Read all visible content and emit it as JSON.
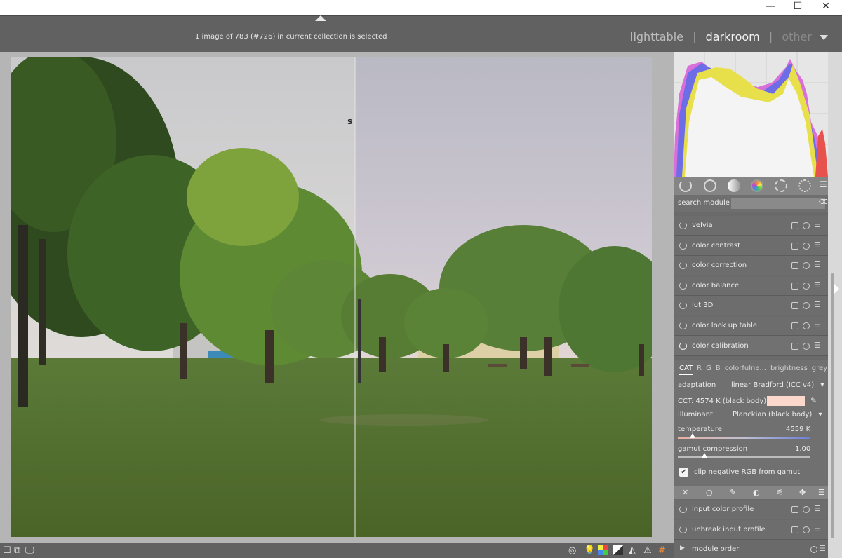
{
  "window": {
    "minimize_icon": "minimize-icon",
    "maximize_icon": "maximize-icon",
    "close_icon": "close-icon",
    "minimize_glyph": "—",
    "maximize_glyph": "☐",
    "close_glyph": "✕"
  },
  "header": {
    "selection_info": "1 image of 783 (#726) in current collection is selected",
    "views": {
      "lighttable": "lighttable",
      "darkroom": "darkroom",
      "other": "other",
      "separator": "|"
    },
    "active_view": "darkroom"
  },
  "image_view": {
    "split_marker": "S"
  },
  "right_panel": {
    "group_tab_icons": [
      "power-icon",
      "circle-icon",
      "tone-icon",
      "color-icon",
      "correct-icon",
      "effect-icon",
      "presets-menu-icon"
    ],
    "search": {
      "label": "search module",
      "value": "",
      "clear_icon": "clear-icon"
    },
    "modules_top": [
      {
        "label": "velvia"
      },
      {
        "label": "color contrast"
      },
      {
        "label": "color correction"
      },
      {
        "label": "color balance"
      },
      {
        "label": "lut 3D"
      },
      {
        "label": "color look up table"
      },
      {
        "label": "color calibration"
      }
    ],
    "color_calibration": {
      "tabs": [
        "CAT",
        "R",
        "G",
        "B",
        "colorfulne...",
        "brightness",
        "grey"
      ],
      "active_tab": "CAT",
      "adaptation_label": "adaptation",
      "adaptation_value": "linear Bradford (ICC v4)",
      "cct_label": "CCT: 4574 K (black body)",
      "cct_swatch_color": "#fcd8cc",
      "illuminant_label": "illuminant",
      "illuminant_value": "Planckian (black body)",
      "temperature_label": "temperature",
      "temperature_value": "4559 K",
      "temperature_fraction": 0.11,
      "gamut_label": "gamut compression",
      "gamut_value": "1.00",
      "gamut_fraction": 0.2,
      "clip_label": "clip negative RGB from gamut",
      "clip_checked": true,
      "dropdown_glyph": "▾"
    },
    "modules_bottom": [
      {
        "label": "input color profile"
      },
      {
        "label": "unbreak input profile"
      }
    ],
    "module_order_label": "module order"
  },
  "colors": {
    "panel_bg": "#6a6a6a",
    "center_bg": "#b5b5b5",
    "header_bg": "#616161",
    "histogram_red": "#e8524c",
    "histogram_blue": "#6d6de8",
    "histogram_yellow": "#e8e04a",
    "histogram_magenta": "#d65ad6"
  }
}
